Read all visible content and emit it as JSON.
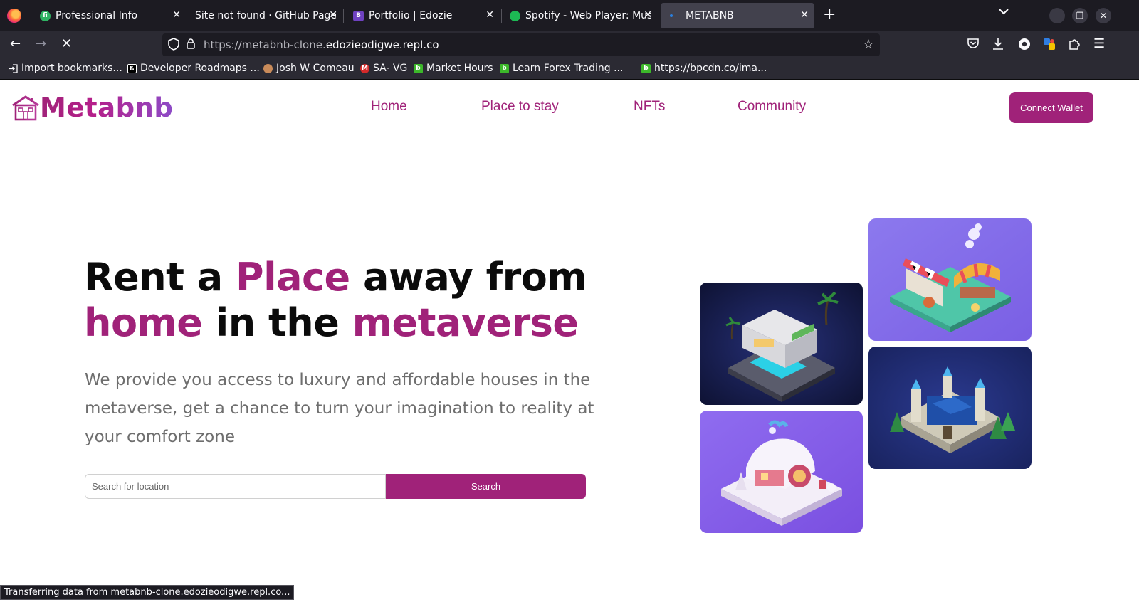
{
  "browser": {
    "tabs": [
      {
        "title": "Professional Info",
        "favicon_color": "#2fb463",
        "favicon_glyph": "fi"
      },
      {
        "title": "Site not found · GitHub Pages",
        "favicon_color": "#1c1b22",
        "favicon_glyph": ""
      },
      {
        "title": "Portfolio | Edozie",
        "favicon_color": "#6f42c1",
        "favicon_glyph": "B"
      },
      {
        "title": "Spotify - Web Player: Music",
        "favicon_color": "#1db954",
        "favicon_glyph": ""
      },
      {
        "title": "METABNB",
        "favicon_color": "#2a80e0",
        "favicon_glyph": ""
      }
    ],
    "url_prefix": "https://metabnb-clone.",
    "url_domain": "edozieodigwe.repl.co",
    "bookmarks": [
      {
        "label": "Import bookmarks...",
        "icon": "import-icon",
        "color": "#2b2a33"
      },
      {
        "label": "Developer Roadmaps ...",
        "icon": "roadmaps-icon",
        "color": "#000000",
        "glyph": "r."
      },
      {
        "label": "Josh W Comeau",
        "icon": "josh-avatar-icon",
        "color": "#c98b5a"
      },
      {
        "label": "SA- VG",
        "icon": "sa-vg-icon",
        "color": "#d42a2a",
        "glyph": "M"
      },
      {
        "label": "Market Hours",
        "icon": "b-icon",
        "color": "#3cb82a",
        "glyph": "b"
      },
      {
        "label": "Learn Forex Trading ...",
        "icon": "b-icon",
        "color": "#3cb82a",
        "glyph": "b"
      },
      {
        "label": "https://bpcdn.co/ima...",
        "icon": "b-icon",
        "color": "#3cb82a",
        "glyph": "b"
      }
    ],
    "status_text": "Transferring data from metabnb-clone.edozieodigwe.repl.co..."
  },
  "site": {
    "brand": "Metabnb",
    "nav": [
      "Home",
      "Place to stay",
      "NFTs",
      "Community"
    ],
    "connect_label": "Connect Wallet",
    "hero": {
      "line1_a": "Rent a ",
      "line1_b": "Place",
      "line1_c": " away from",
      "line2_a": "home",
      "line2_b": " in the ",
      "line2_c": "metaverse",
      "subtitle": "We provide you access to luxury and affordable houses in the metaverse, get a chance to turn your imagination to reality at your comfort zone"
    },
    "search": {
      "placeholder": "Search for location",
      "button_label": "Search"
    },
    "accent_color": "#a02279"
  }
}
